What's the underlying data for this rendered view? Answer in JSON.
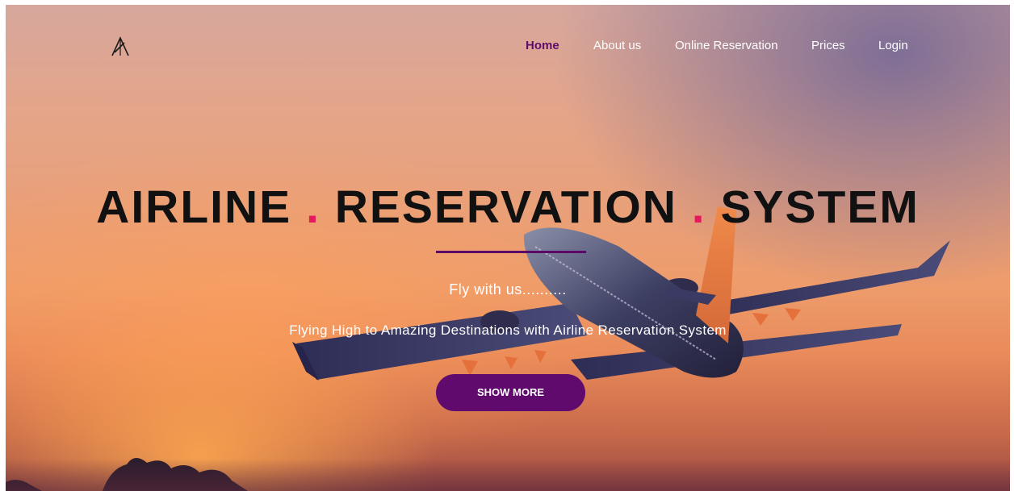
{
  "nav": {
    "logo_icon": "triangle-lines-logo-icon",
    "items": [
      {
        "label": "Home",
        "active": true
      },
      {
        "label": "About us",
        "active": false
      },
      {
        "label": "Online Reservation",
        "active": false
      },
      {
        "label": "Prices",
        "active": false
      },
      {
        "label": "Login",
        "active": false
      }
    ]
  },
  "hero": {
    "title_part1": "AIRLINE",
    "title_part2": "RESERVATION",
    "title_part3": "SYSTEM",
    "separator": ".",
    "tagline": "Fly with us..........",
    "subline": "Flying High to Amazing Destinations with Airline Reservation System",
    "cta_label": "SHOW MORE"
  },
  "colors": {
    "accent_purple": "#600a6e",
    "dot_pink": "#e6195e",
    "title_text": "#111111",
    "nav_text": "#ffffff"
  }
}
